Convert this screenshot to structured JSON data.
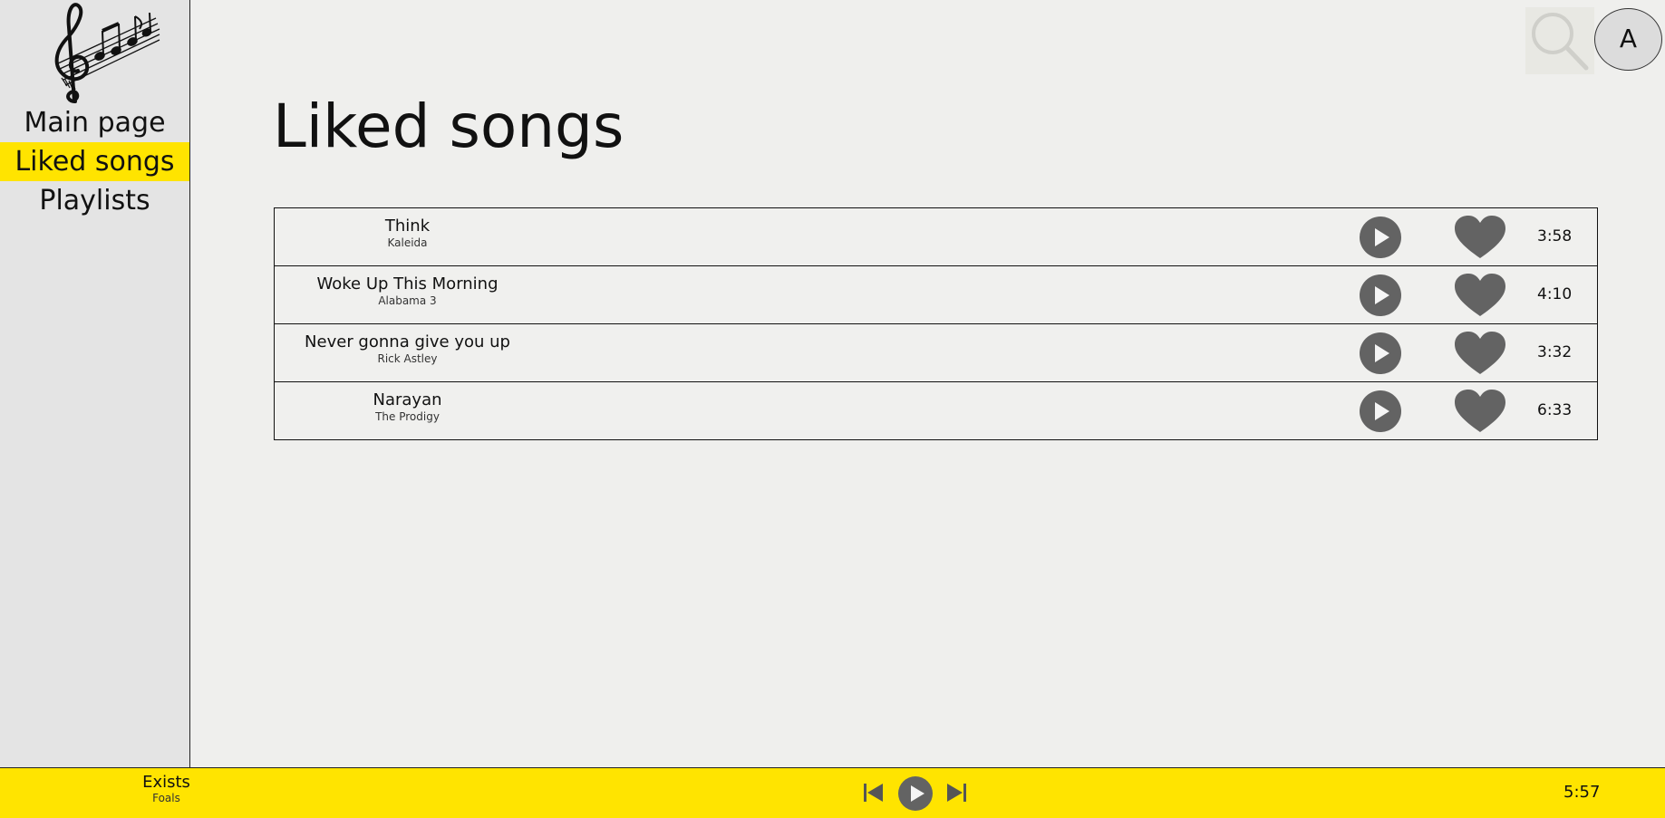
{
  "sidebar": {
    "logo_icon": "treble-clef-music-notes-icon",
    "items": [
      {
        "label": "Main page",
        "active": false
      },
      {
        "label": "Liked songs",
        "active": true
      },
      {
        "label": "Playlists",
        "active": false
      }
    ]
  },
  "header": {
    "search_icon": "search-icon",
    "avatar_letter": "A"
  },
  "main": {
    "title": "Liked songs",
    "songs": [
      {
        "title": "Think",
        "artist": "Kaleida",
        "duration": "3:58",
        "liked": true
      },
      {
        "title": "Woke Up This Morning",
        "artist": "Alabama 3",
        "duration": "4:10",
        "liked": true
      },
      {
        "title": "Never gonna give you up",
        "artist": "Rick Astley",
        "duration": "3:32",
        "liked": true
      },
      {
        "title": "Narayan",
        "artist": "The Prodigy",
        "duration": "6:33",
        "liked": true
      }
    ]
  },
  "player": {
    "title": "Exists",
    "artist": "Foals",
    "time": "5:57",
    "icons": [
      "skip-previous-icon",
      "play-icon",
      "skip-next-icon"
    ]
  },
  "colors": {
    "accent": "#ffe400",
    "background": "#efefed",
    "sidebar_bg": "#e4e4e4",
    "icon_gray": "#636363"
  }
}
